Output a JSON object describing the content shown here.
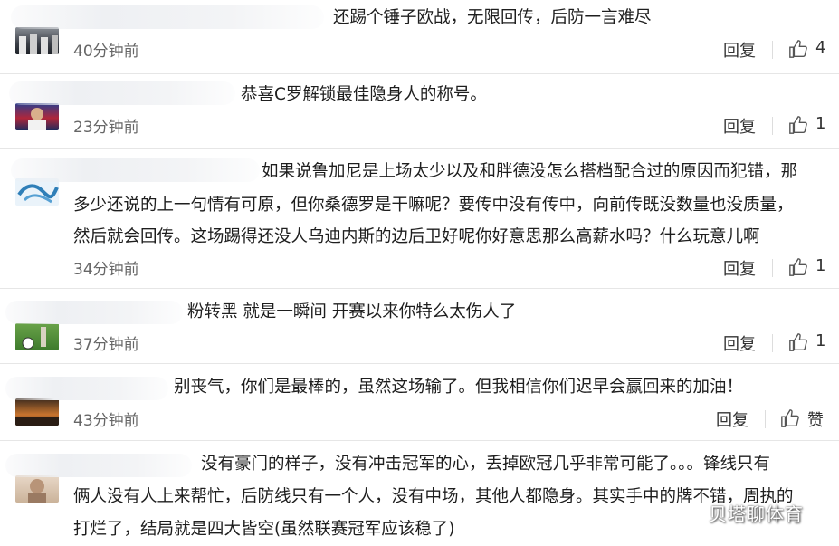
{
  "comments": [
    {
      "text": [
        "还踢个锤子欧战，无限回传，后防一言难尽"
      ],
      "time": "40分钟前",
      "reply": "回复",
      "likes": "4"
    },
    {
      "text": [
        "恭喜C罗解锁最佳隐身人的称号。"
      ],
      "time": "23分钟前",
      "reply": "回复",
      "likes": "1"
    },
    {
      "text": [
        "如果说鲁加尼是上场太少以及和胖德没怎么搭档配合过的原因而犯错，那",
        "多少还说的上一句情有可原，但你桑德罗是干嘛呢？要传中没有传中，向前传既没数量也没质量，",
        "然后就会回传。这场踢得还没人乌迪内斯的边后卫好呢你好意思那么高薪水吗？什么玩意儿啊"
      ],
      "time": "34分钟前",
      "reply": "回复",
      "likes": "1"
    },
    {
      "text": [
        "粉转黑 就是一瞬间 开赛以来你特么太伤人了"
      ],
      "time": "37分钟前",
      "reply": "回复",
      "likes": "1"
    },
    {
      "text": [
        "别丧气，你们是最棒的，虽然这场输了。但我相信你们迟早会赢回来的加油！"
      ],
      "time": "43分钟前",
      "reply": "回复",
      "likes": "赞"
    },
    {
      "text": [
        "没有豪门的样子，没有冲击冠军的心，丢掉欧冠几乎非常可能了。。。锋线只有",
        "俩人没有人上来帮忙，后防线只有一个人，没有中场，其他人都隐身。其实手中的牌不错，周执的",
        "打烂了，结局就是四大皆空(虽然联赛冠军应该稳了)"
      ],
      "time": "",
      "reply": "",
      "likes": ""
    }
  ],
  "watermark": "贝塔聊体育"
}
